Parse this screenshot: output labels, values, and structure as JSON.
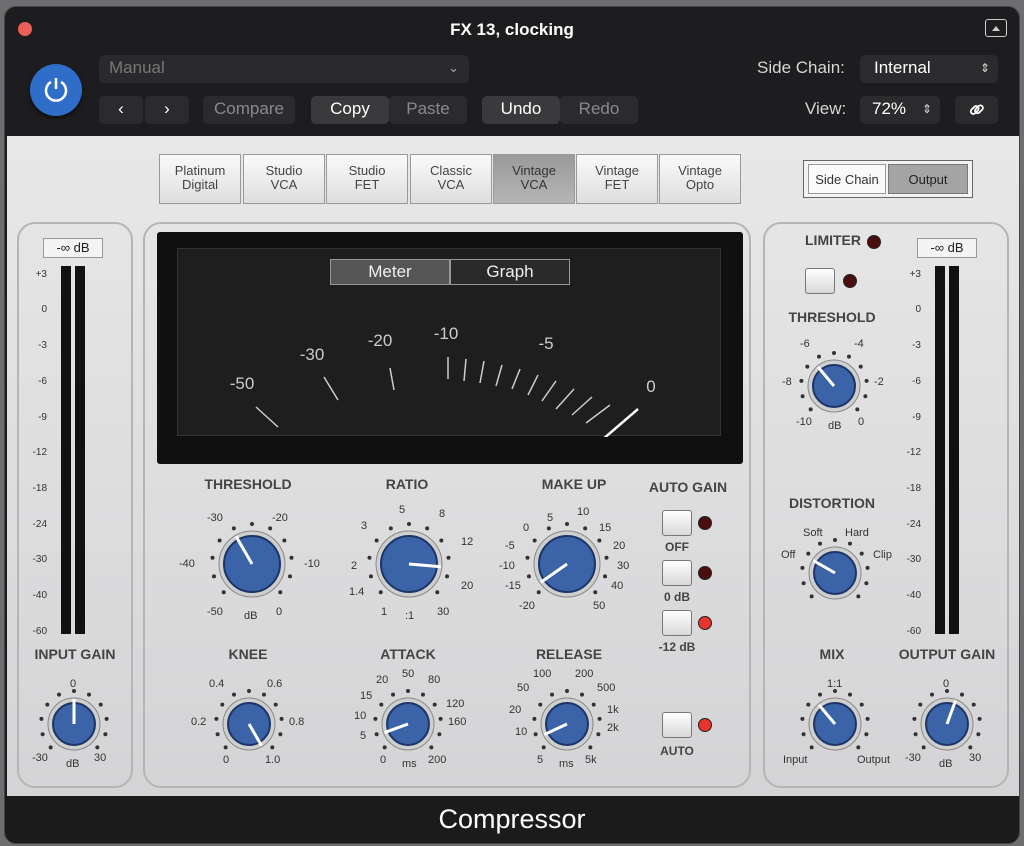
{
  "window": {
    "title": "FX 13, clocking"
  },
  "header": {
    "preset": "Manual",
    "back": "‹",
    "forward": "›",
    "compare": "Compare",
    "copy": "Copy",
    "paste": "Paste",
    "undo": "Undo",
    "redo": "Redo",
    "side_chain_label": "Side Chain:",
    "side_chain_value": "Internal",
    "view_label": "View:",
    "view_value": "72%"
  },
  "models": [
    "Platinum\nDigital",
    "Studio\nVCA",
    "Studio\nFET",
    "Classic\nVCA",
    "Vintage\nVCA",
    "Vintage\nFET",
    "Vintage\nOpto"
  ],
  "selected_model": "Vintage VCA",
  "view_toggle": {
    "side_chain": "Side Chain",
    "output": "Output",
    "selected": "Output"
  },
  "meter": {
    "tabs": [
      "Meter",
      "Graph"
    ],
    "selected": "Meter",
    "scale": [
      "-50",
      "-30",
      "-20",
      "-10",
      "-5",
      "0"
    ]
  },
  "input": {
    "readout": "-∞ dB",
    "label": "INPUT GAIN",
    "scale": [
      "+3",
      "0",
      "-3",
      "-6",
      "-9",
      "-12",
      "-18",
      "-24",
      "-30",
      "-40",
      "-60"
    ],
    "knob_min": "-30",
    "knob_max": "30",
    "knob_top": "0",
    "unit": "dB"
  },
  "output": {
    "readout": "-∞ dB",
    "label": "OUTPUT GAIN",
    "knob_min": "-30",
    "knob_max": "30",
    "knob_top": "0",
    "unit": "dB"
  },
  "knobs": {
    "threshold": {
      "label": "THRESHOLD",
      "scale": [
        "-30",
        "-20",
        "-40",
        "-10",
        "-50",
        "0"
      ],
      "unit": "dB"
    },
    "ratio": {
      "label": "RATIO",
      "scale": [
        "5",
        "3",
        "8",
        "12",
        "2",
        "20",
        "1.4",
        "30",
        "1"
      ],
      "unit": ":1"
    },
    "makeup": {
      "label": "MAKE UP",
      "scale": [
        "5",
        "10",
        "0",
        "15",
        "-5",
        "20",
        "-10",
        "30",
        "-15",
        "40",
        "-20",
        "50"
      ]
    },
    "knee": {
      "label": "KNEE",
      "scale": [
        "0.4",
        "0.6",
        "0.2",
        "0.8",
        "0",
        "1.0"
      ]
    },
    "attack": {
      "label": "ATTACK",
      "scale": [
        "50",
        "20",
        "80",
        "15",
        "120",
        "10",
        "160",
        "5",
        "0",
        "200"
      ],
      "unit": "ms"
    },
    "release": {
      "label": "RELEASE",
      "scale": [
        "100",
        "200",
        "50",
        "500",
        "20",
        "1k",
        "2k",
        "10",
        "5",
        "5k"
      ],
      "unit": "ms"
    }
  },
  "auto_gain": {
    "label": "AUTO GAIN",
    "options": [
      "OFF",
      "0 dB",
      "-12 dB"
    ],
    "selected": "-12 dB",
    "auto": "AUTO"
  },
  "limiter": {
    "label": "LIMITER",
    "threshold_label": "THRESHOLD",
    "scale": [
      "-6",
      "-4",
      "-8",
      "-2",
      "-10",
      "0"
    ],
    "unit": "dB"
  },
  "distortion": {
    "label": "DISTORTION",
    "scale": [
      "Soft",
      "Hard",
      "Off",
      "Clip"
    ]
  },
  "mix": {
    "label": "MIX",
    "top": "1:1",
    "left": "Input",
    "right": "Output"
  },
  "footer": {
    "name": "Compressor"
  }
}
